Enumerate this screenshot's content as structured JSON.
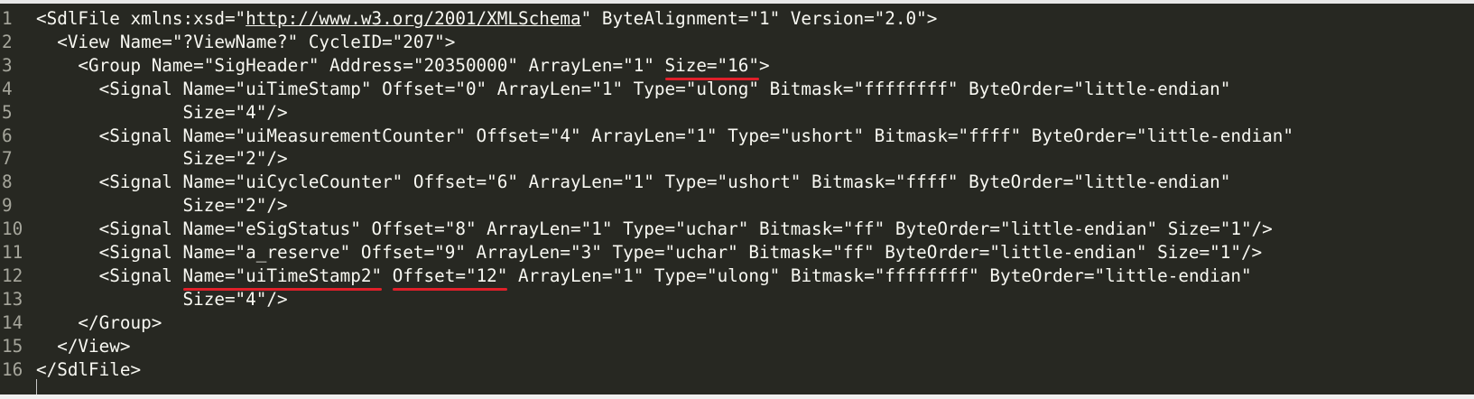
{
  "editor": {
    "lines": [
      {
        "num": "1",
        "parts": [
          {
            "t": "<SdlFile xmlns:xsd=\""
          },
          {
            "t": "http://www.w3.org/2001/XMLSchema",
            "u": true
          },
          {
            "t": "\" ByteAlignment=\"1\" Version=\"2.0\">"
          }
        ]
      },
      {
        "num": "2",
        "parts": [
          {
            "t": "  <View Name=\"?ViewName?\" CycleID=\"207\">"
          }
        ]
      },
      {
        "num": "3",
        "parts": [
          {
            "t": "    <Group Name=\"SigHeader\" Address=\"20350000\" ArrayLen=\"1\" "
          },
          {
            "t": "Size=\"16\"",
            "m": true
          },
          {
            "t": ">"
          }
        ]
      },
      {
        "num": "4",
        "parts": [
          {
            "t": "      <Signal Name=\"uiTimeStamp\" Offset=\"0\" ArrayLen=\"1\" Type=\"ulong\" Bitmask=\"ffffffff\" ByteOrder=\"little-endian\""
          }
        ]
      },
      {
        "num": "5",
        "parts": [
          {
            "t": "              Size=\"4\"/>"
          }
        ]
      },
      {
        "num": "6",
        "parts": [
          {
            "t": "      <Signal Name=\"uiMeasurementCounter\" Offset=\"4\" ArrayLen=\"1\" Type=\"ushort\" Bitmask=\"ffff\" ByteOrder=\"little-endian\""
          }
        ]
      },
      {
        "num": "7",
        "parts": [
          {
            "t": "              Size=\"2\"/>"
          }
        ]
      },
      {
        "num": "8",
        "parts": [
          {
            "t": "      <Signal Name=\"uiCycleCounter\" Offset=\"6\" ArrayLen=\"1\" Type=\"ushort\" Bitmask=\"ffff\" ByteOrder=\"little-endian\""
          }
        ]
      },
      {
        "num": "9",
        "parts": [
          {
            "t": "              Size=\"2\"/>"
          }
        ]
      },
      {
        "num": "10",
        "parts": [
          {
            "t": "      <Signal Name=\"eSigStatus\" Offset=\"8\" ArrayLen=\"1\" Type=\"uchar\" Bitmask=\"ff\" ByteOrder=\"little-endian\" Size=\"1\"/>"
          }
        ]
      },
      {
        "num": "11",
        "parts": [
          {
            "t": "      <Signal Name=\"a_reserve\" Offset=\"9\" ArrayLen=\"3\" Type=\"uchar\" Bitmask=\"ff\" ByteOrder=\"little-endian\" Size=\"1\"/>"
          }
        ]
      },
      {
        "num": "12",
        "parts": [
          {
            "t": "      <Signal "
          },
          {
            "t": "Name=\"uiTimeStamp2\"",
            "m": true
          },
          {
            "t": " "
          },
          {
            "t": "Offset=\"12\"",
            "m": true
          },
          {
            "t": " ArrayLen=\"1\" Type=\"ulong\" Bitmask=\"ffffffff\" ByteOrder=\"little-endian\""
          }
        ]
      },
      {
        "num": "13",
        "parts": [
          {
            "t": "              Size=\"4\"/>"
          }
        ]
      },
      {
        "num": "14",
        "parts": [
          {
            "t": "    </Group>"
          }
        ]
      },
      {
        "num": "15",
        "parts": [
          {
            "t": "  </View>"
          }
        ]
      },
      {
        "num": "16",
        "parts": [
          {
            "t": "</SdlFile>"
          }
        ]
      }
    ]
  }
}
